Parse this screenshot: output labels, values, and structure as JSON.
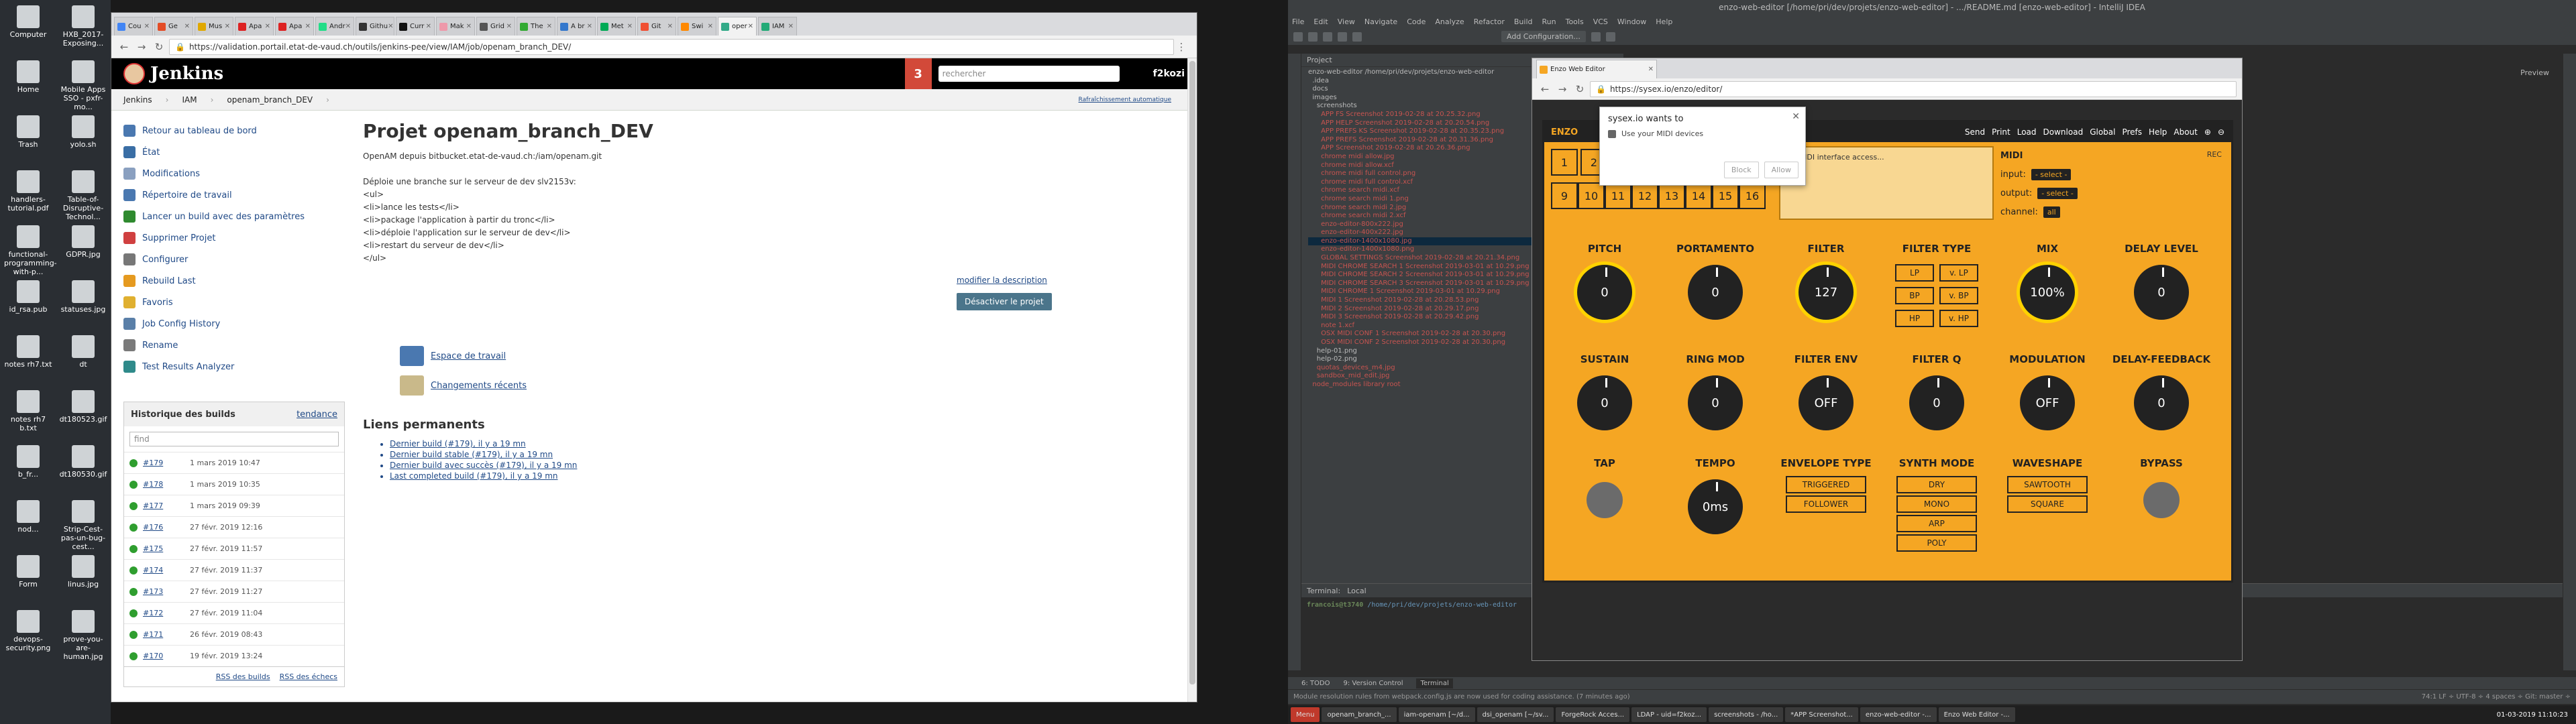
{
  "desktop_left": {
    "icons": [
      "Computer",
      "HXB_2017-Exposing...",
      "Home",
      "Mobile Apps SSO - pxfr-mo...",
      "Trash",
      "yolo.sh",
      "handlers-tutorial.pdf",
      "Table-of-Disruptive-Technol...",
      "functional-programming-with-p...",
      "GDPR.jpg",
      "id_rsa.pub",
      "statuses.jpg",
      "notes rh7.txt",
      "dt",
      "notes rh7 b.txt",
      "dt180523.gif",
      "b_fr...",
      "dt180530.gif",
      "nod...",
      "Strip-Cest-pas-un-bug-cest...",
      "Form",
      "linus.jpg",
      "devops-security.png",
      "prove-you-are-human.jpg"
    ]
  },
  "browser1": {
    "tabs": [
      "Cou",
      "Ge",
      "Mus",
      "Apa",
      "Apa",
      "Andr",
      "Githu",
      "Curr",
      "Mak",
      "Grid",
      "The",
      "A br",
      "Met",
      "Git",
      "Swi",
      "oper",
      "IAM"
    ],
    "url": "https://validation.portail.etat-de-vaud.ch/outils/jenkins-pee/view/IAM/job/openam_branch_DEV/"
  },
  "jenkins": {
    "logo": "Jenkins",
    "notif_count": "3",
    "search_placeholder": "rechercher",
    "user": "f2kozi",
    "breadcrumb": [
      "Jenkins",
      "IAM",
      "openam_branch_DEV"
    ],
    "auto_refresh": "Rafraîchissement automatique",
    "side": [
      "Retour au tableau de bord",
      "État",
      "Modifications",
      "Répertoire de travail",
      "Lancer un build avec des paramètres",
      "Supprimer Projet",
      "Configurer",
      "Rebuild Last",
      "Favoris",
      "Job Config History",
      "Rename",
      "Test Results Analyzer"
    ],
    "history_title": "Historique des builds",
    "trend": "tendance",
    "find": "find",
    "builds": [
      {
        "num": "#179",
        "date": "1 mars 2019 10:47"
      },
      {
        "num": "#178",
        "date": "1 mars 2019 10:35"
      },
      {
        "num": "#177",
        "date": "1 mars 2019 09:39"
      },
      {
        "num": "#176",
        "date": "27 févr. 2019 12:16"
      },
      {
        "num": "#175",
        "date": "27 févr. 2019 11:57"
      },
      {
        "num": "#174",
        "date": "27 févr. 2019 11:37"
      },
      {
        "num": "#173",
        "date": "27 févr. 2019 11:27"
      },
      {
        "num": "#172",
        "date": "27 févr. 2019 11:04"
      },
      {
        "num": "#171",
        "date": "26 févr. 2019 08:43"
      },
      {
        "num": "#170",
        "date": "19 févr. 2019 13:24"
      }
    ],
    "rss_all": "RSS des builds",
    "rss_fail": "RSS des échecs",
    "title": "Projet openam_branch_DEV",
    "desc": [
      "OpenAM depuis bitbucket.etat-de-vaud.ch:/iam/openam.git",
      "",
      "Déploie une branche sur le serveur de dev slv2153v:",
      "<ul>",
      "  <li>lance les tests</li>",
      "  <li>package l'application à partir du tronc</li>",
      "  <li>déploie l'application sur le serveur de dev</li>",
      "  <li>restart du serveur de dev</li>",
      "</ul>"
    ],
    "edit_desc": "modifier la description",
    "disable": "Désactiver le projet",
    "workspace": "Espace de travail",
    "changes": "Changements récents",
    "perm_title": "Liens permanents",
    "perm_links": [
      "Dernier build (#179), il y a 19 mn",
      "Dernier build stable (#179), il y a 19 mn",
      "Dernier build avec succès (#179), il y a 19 mn",
      "Last completed build (#179), il y a 19 mn"
    ]
  },
  "idea": {
    "title": "enzo-web-editor [/home/pri/dev/projets/enzo-web-editor] - .../README.md [enzo-web-editor] - IntelliJ IDEA",
    "menu": [
      "File",
      "Edit",
      "View",
      "Navigate",
      "Code",
      "Analyze",
      "Refactor",
      "Build",
      "Run",
      "Tools",
      "VCS",
      "Window",
      "Help"
    ],
    "add_config": "Add Configuration...",
    "project_label": "Project",
    "tree": [
      {
        "t": "enzo-web-editor /home/pri/dev/projets/enzo-web-editor",
        "c": "d"
      },
      {
        "t": "  .idea",
        "c": "d"
      },
      {
        "t": "  docs",
        "c": "d"
      },
      {
        "t": "  images",
        "c": "d"
      },
      {
        "t": "    screenshots",
        "c": "d"
      },
      {
        "t": "      APP FS Screenshot 2019-02-28 at 20.25.32.png",
        "c": "f"
      },
      {
        "t": "      APP HELP Screenshot 2019-02-28 at 20.20.54.png",
        "c": "f"
      },
      {
        "t": "      APP PREFS KS Screenshot 2019-02-28 at 20.35.23.png",
        "c": "f"
      },
      {
        "t": "      APP PREFS Screenshot 2019-02-28 at 20.31.36.png",
        "c": "f"
      },
      {
        "t": "      APP Screenshot 2019-02-28 at 20.26.36.png",
        "c": "f"
      },
      {
        "t": "      chrome midi allow.jpg",
        "c": "f"
      },
      {
        "t": "      chrome midi allow.xcf",
        "c": "f"
      },
      {
        "t": "      chrome midi full control.png",
        "c": "f"
      },
      {
        "t": "      chrome midi full control.xcf",
        "c": "f"
      },
      {
        "t": "      chrome search midi.xcf",
        "c": "f"
      },
      {
        "t": "      chrome search midi 1.png",
        "c": "f"
      },
      {
        "t": "      chrome search midi 2.jpg",
        "c": "f"
      },
      {
        "t": "      chrome search midi 2.xcf",
        "c": "f"
      },
      {
        "t": "      enzo-editor-800x222.jpg",
        "c": "f"
      },
      {
        "t": "      enzo-editor-400x222.jpg",
        "c": "f"
      },
      {
        "t": "      enzo-editor-1400x1080.jpg",
        "c": "sel"
      },
      {
        "t": "      enzo-editor-1400x1080.png",
        "c": "f"
      },
      {
        "t": "      GLOBAL SETTINGS Screenshot 2019-02-28 at 20.21.34.png",
        "c": "f"
      },
      {
        "t": "      MIDI CHROME SEARCH 1 Screenshot 2019-03-01 at 10.29.png",
        "c": "f"
      },
      {
        "t": "      MIDI CHROME SEARCH 2 Screenshot 2019-03-01 at 10.29.png",
        "c": "f"
      },
      {
        "t": "      MIDI CHROME SEARCH 3 Screenshot 2019-03-01 at 10.29.png",
        "c": "f"
      },
      {
        "t": "      MIDI CHROME 1 Screenshot 2019-03-01 at 10.29.png",
        "c": "f"
      },
      {
        "t": "      MIDI 1 Screenshot 2019-02-28 at 20.28.53.png",
        "c": "f"
      },
      {
        "t": "      MIDI 2 Screenshot 2019-02-28 at 20.29.17.png",
        "c": "f"
      },
      {
        "t": "      MIDI 3 Screenshot 2019-02-28 at 20.29.42.png",
        "c": "f"
      },
      {
        "t": "      note 1.xcf",
        "c": "f"
      },
      {
        "t": "      OSX MIDI CONF 1 Screenshot 2019-02-28 at 20.30.png",
        "c": "f"
      },
      {
        "t": "      OSX MIDI CONF 2 Screenshot 2019-02-28 at 20.30.png",
        "c": "f"
      },
      {
        "t": "    help-01.png",
        "c": "d"
      },
      {
        "t": "    help-02.png",
        "c": "d"
      },
      {
        "t": "    quotas_devices_m4.jpg",
        "c": "f"
      },
      {
        "t": "    sandbox_mid_edit.jpg",
        "c": "f"
      },
      {
        "t": "  node_modules library root",
        "c": "f"
      }
    ],
    "doc_hint": "Preview",
    "terminal_title": "Terminal:",
    "terminal_tab": "Local",
    "prompt_user": "francois@t3740",
    "prompt_path": " /home/pri/dev/projets/enzo-web-editor",
    "bottom_tabs": [
      "6: TODO",
      "9: Version Control",
      "Terminal"
    ],
    "status": "Module resolution rules from webpack.config.js are now used for coding assistance. (7 minutes ago)",
    "status_right": "74:1  LF ÷  UTF-8 ÷  4 spaces ÷  Git: master ÷",
    "taskbar": [
      "Menu",
      "openam_branch_...",
      "iam-openam [~/d...",
      "dsi_openam [~/sv...",
      "ForgeRock Acces...",
      "LDAP - uid=f2koz...",
      "screenshots - /ho...",
      "*APP Screenshot...",
      "enzo-web-editor -...",
      "Enzo Web Editor -..."
    ],
    "clock": "01-03-2019 11:10:23"
  },
  "enzo": {
    "tab": "Enzo Web Editor",
    "url": "https://sysex.io/enzo/editor/",
    "dialog_title": "sysex.io wants to",
    "dialog_msg": "Use your MIDI devices",
    "block": "Block",
    "allow": "Allow",
    "brand": "ENZO",
    "menu": [
      "Send",
      "Print",
      "Load",
      "Download",
      "Global",
      "Prefs",
      "Help",
      "About"
    ],
    "progs_row1": [
      "1",
      "2"
    ],
    "progs_row2": [
      "9",
      "10",
      "11",
      "12",
      "13",
      "14",
      "15",
      "16"
    ],
    "hint": "for MIDI interface access...",
    "midi_label": "MIDI",
    "rec": "REC",
    "midi_input": "input:",
    "midi_output": "output:",
    "midi_channel": "channel:",
    "select_ph": "- select -",
    "channel_val": "all",
    "knobs": [
      {
        "label": "PITCH",
        "val": "0",
        "hl": true
      },
      {
        "label": "PORTAMENTO",
        "val": "0"
      },
      {
        "label": "FILTER",
        "val": "127",
        "hl": true
      },
      {
        "label": "MIX",
        "val": "100%",
        "hl": true
      },
      {
        "label": "DELAY LEVEL",
        "val": "0"
      },
      {
        "label": "SUSTAIN",
        "val": "0"
      },
      {
        "label": "RING MOD",
        "val": "0"
      },
      {
        "label": "FILTER ENV",
        "val": "OFF"
      },
      {
        "label": "FILTER Q",
        "val": "0"
      },
      {
        "label": "MODULATION",
        "val": "OFF"
      },
      {
        "label": "DELAY-FEEDBACK",
        "val": "0"
      },
      {
        "label": "TEMPO",
        "val": "0ms"
      }
    ],
    "filter_type_label": "FILTER TYPE",
    "filter_types": [
      "LP",
      "v. LP",
      "BP",
      "v. BP",
      "HP",
      "v. HP"
    ],
    "tap": "TAP",
    "env_type_label": "ENVELOPE TYPE",
    "env_types": [
      "TRIGGERED",
      "FOLLOWER"
    ],
    "synth_mode_label": "SYNTH MODE",
    "synth_modes": [
      "DRY",
      "MONO",
      "ARP",
      "POLY"
    ],
    "wave_label": "WAVESHAPE",
    "waves": [
      "SAWTOOTH",
      "SQUARE"
    ],
    "bypass": "BYPASS"
  }
}
